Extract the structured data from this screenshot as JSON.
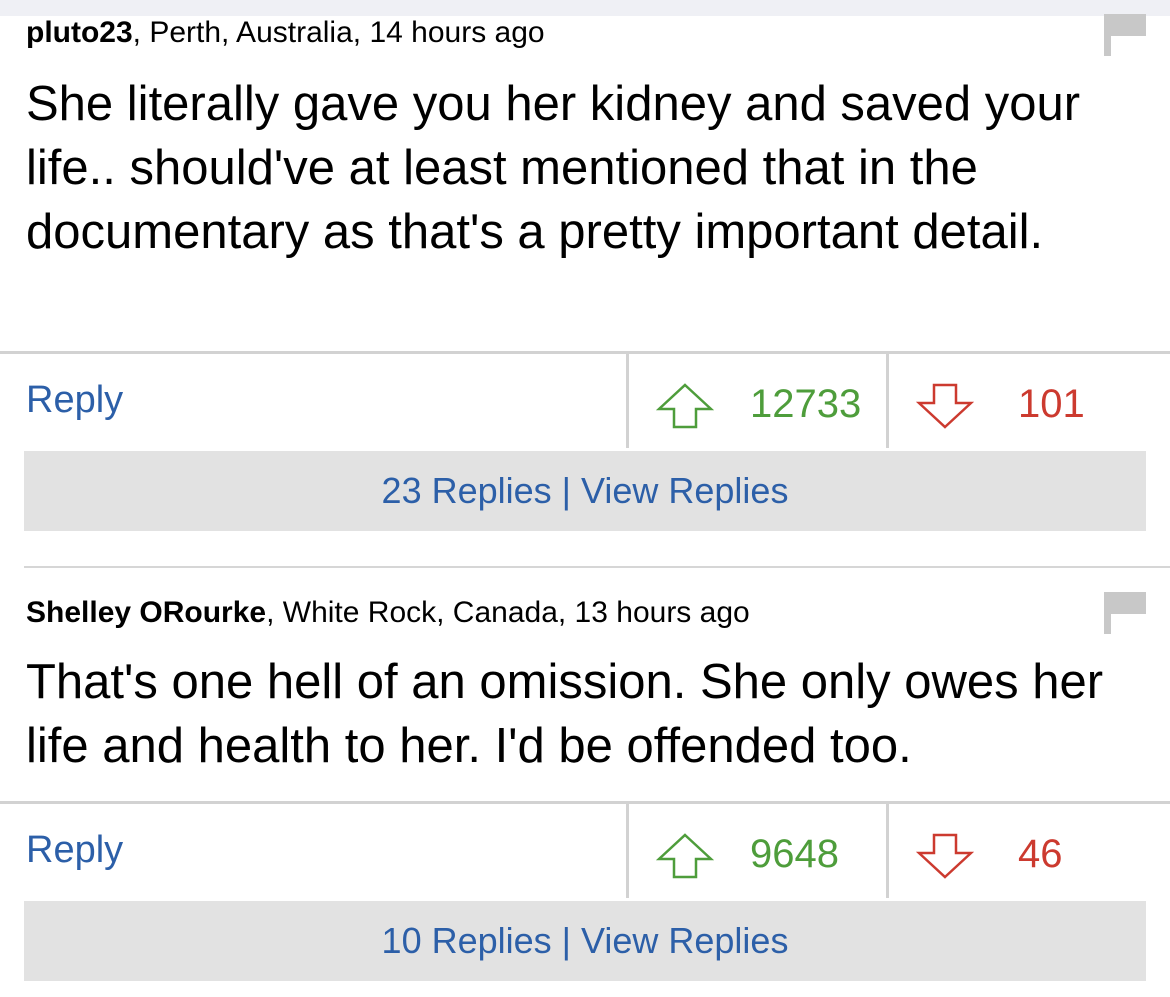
{
  "comments": [
    {
      "author": "pluto23",
      "meta": ", Perth, Australia, 14 hours ago",
      "body": "She literally gave you her kidney and saved your life.. should've at least mentioned that in the documentary as that's a pretty important detail.",
      "reply_label": "Reply",
      "upvotes": "12733",
      "downvotes": "101",
      "replies_link": "23 Replies | View Replies"
    },
    {
      "author": "Shelley ORourke",
      "meta": ", White Rock, Canada, 13 hours ago",
      "body": "That's one hell of an omission. She only owes her life and health to her. I'd be offended too.",
      "reply_label": "Reply",
      "upvotes": "9648",
      "downvotes": "46",
      "replies_link": "10 Replies | View Replies"
    }
  ],
  "icons": {
    "flag": "flag-icon",
    "upvote": "arrow-up-icon",
    "downvote": "arrow-down-icon"
  },
  "colors": {
    "link": "#2c5fa8",
    "upvote": "#4e9d3b",
    "downvote": "#cc3a2f",
    "flag": "#c8c8c8",
    "replies_bar": "#e2e2e2"
  }
}
